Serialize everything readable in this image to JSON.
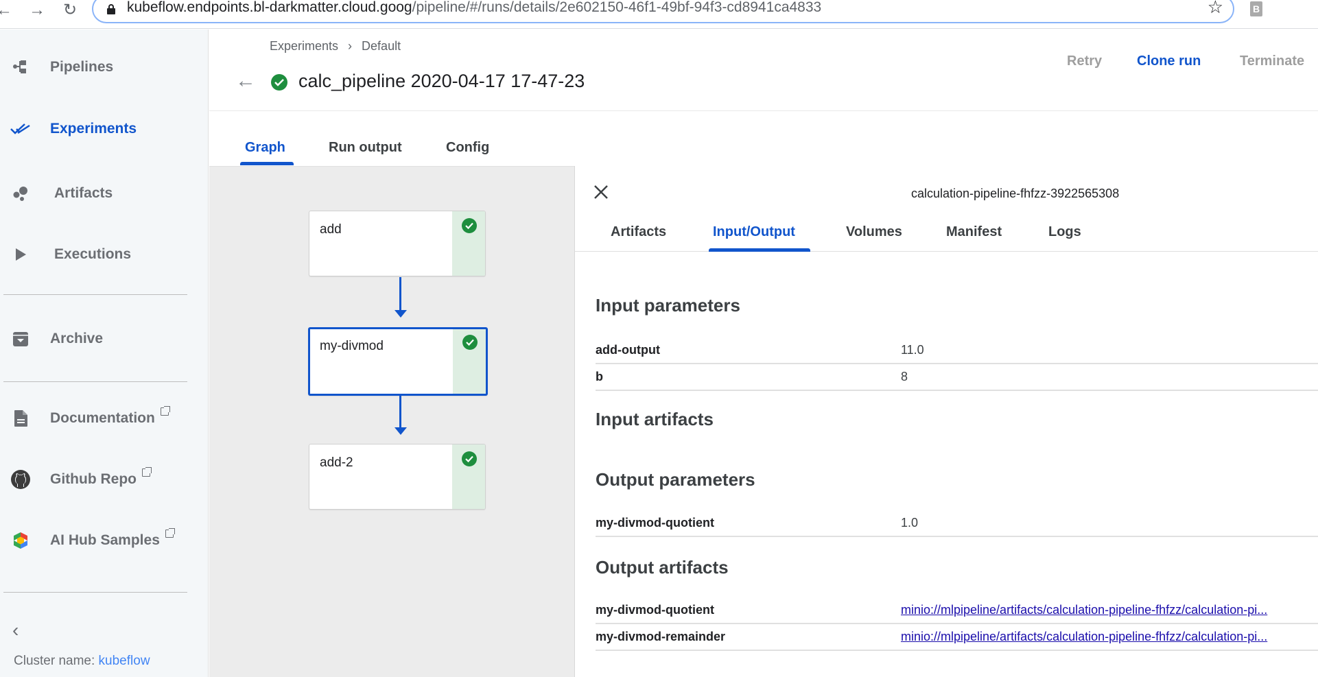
{
  "browser": {
    "url_host": "kubeflow.endpoints.bl-darkmatter.cloud.goog",
    "url_path": "/pipeline/#/runs/details/2e602150-46f1-49bf-94f3-cd8941ca4833",
    "extension_label": "B"
  },
  "sidebar": {
    "items": [
      {
        "label": "Pipelines",
        "icon": "pipelines-icon",
        "active": false
      },
      {
        "label": "Experiments",
        "icon": "experiments-icon",
        "active": true
      },
      {
        "label": "Artifacts",
        "icon": "artifacts-icon",
        "active": false
      },
      {
        "label": "Executions",
        "icon": "executions-icon",
        "active": false
      },
      {
        "label": "Archive",
        "icon": "archive-icon",
        "active": false
      },
      {
        "label": "Documentation",
        "icon": "documentation-icon",
        "external": true
      },
      {
        "label": "Github Repo",
        "icon": "github-icon",
        "external": true
      },
      {
        "label": "AI Hub Samples",
        "icon": "ai-hub-icon",
        "external": true
      }
    ],
    "cluster_label": "Cluster name: ",
    "cluster_name": "kubeflow"
  },
  "header": {
    "breadcrumb": [
      "Experiments",
      "Default"
    ],
    "breadcrumb_separator": "›",
    "run_title": "calc_pipeline 2020-04-17 17-47-23",
    "status": "succeeded",
    "actions": {
      "retry": "Retry",
      "clone": "Clone run",
      "terminate": "Terminate"
    }
  },
  "main_tabs": [
    {
      "label": "Graph",
      "active": true
    },
    {
      "label": "Run output",
      "active": false
    },
    {
      "label": "Config",
      "active": false
    }
  ],
  "graph": {
    "nodes": [
      {
        "label": "add",
        "status": "succeeded",
        "selected": false
      },
      {
        "label": "my-divmod",
        "status": "succeeded",
        "selected": true
      },
      {
        "label": "add-2",
        "status": "succeeded",
        "selected": false
      }
    ],
    "edges": [
      [
        "add",
        "my-divmod"
      ],
      [
        "my-divmod",
        "add-2"
      ]
    ]
  },
  "panel": {
    "title": "calculation-pipeline-fhfzz-3922565308",
    "tabs": [
      {
        "label": "Artifacts",
        "active": false
      },
      {
        "label": "Input/Output",
        "active": true
      },
      {
        "label": "Volumes",
        "active": false
      },
      {
        "label": "Manifest",
        "active": false
      },
      {
        "label": "Logs",
        "active": false
      }
    ],
    "input_parameters_title": "Input parameters",
    "input_parameters": [
      {
        "key": "add-output",
        "value": "11.0"
      },
      {
        "key": "b",
        "value": "8"
      }
    ],
    "input_artifacts_title": "Input artifacts",
    "output_parameters_title": "Output parameters",
    "output_parameters": [
      {
        "key": "my-divmod-quotient",
        "value": "1.0"
      }
    ],
    "output_artifacts_title": "Output artifacts",
    "output_artifacts": [
      {
        "key": "my-divmod-quotient",
        "value": "minio://mlpipeline/artifacts/calculation-pipeline-fhfzz/calculation-pi..."
      },
      {
        "key": "my-divmod-remainder",
        "value": "minio://mlpipeline/artifacts/calculation-pipeline-fhfzz/calculation-pi..."
      }
    ]
  },
  "colors": {
    "accent": "#1155cc",
    "success": "#1e8e3e",
    "success_bg": "#deeee2",
    "sidebar_bg": "#f4f7f9",
    "graph_bg": "#ececec"
  }
}
